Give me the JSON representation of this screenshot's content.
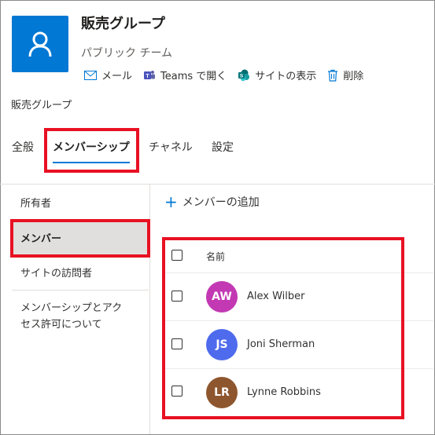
{
  "group": {
    "title": "販売グループ",
    "subtitle": "パブリック チーム",
    "icon": "person-icon",
    "color": "#0078d4"
  },
  "actions": [
    {
      "label": "メール",
      "icon": "mail-icon"
    },
    {
      "label": "Teams で開く",
      "icon": "teams-icon"
    },
    {
      "label": "サイトの表示",
      "icon": "sharepoint-icon"
    },
    {
      "label": "削除",
      "icon": "trash-icon"
    }
  ],
  "breadcrumb": "販売グループ",
  "tabs": [
    "全般",
    "メンバーシップ",
    "チャネル",
    "設定"
  ],
  "active_tab": "メンバーシップ",
  "sidebar": {
    "items": [
      "所有者",
      "メンバー",
      "サイトの訪問者",
      "メンバーシップとアクセス許可について"
    ],
    "item_about_line1": "メンバーシップとアク",
    "item_about_line2": "セス許可について",
    "selected": "メンバー"
  },
  "main": {
    "add_member_label": "メンバーの追加",
    "column_name": "名前",
    "members": [
      {
        "initials": "AW",
        "name": "Alex Wilber",
        "color": "#c239b3"
      },
      {
        "initials": "JS",
        "name": "Joni Sherman",
        "color": "#4f6bed"
      },
      {
        "initials": "LR",
        "name": "Lynne Robbins",
        "color": "#8e562e"
      }
    ]
  },
  "colors": {
    "accent": "#0078d4",
    "highlight": "#e81123"
  }
}
